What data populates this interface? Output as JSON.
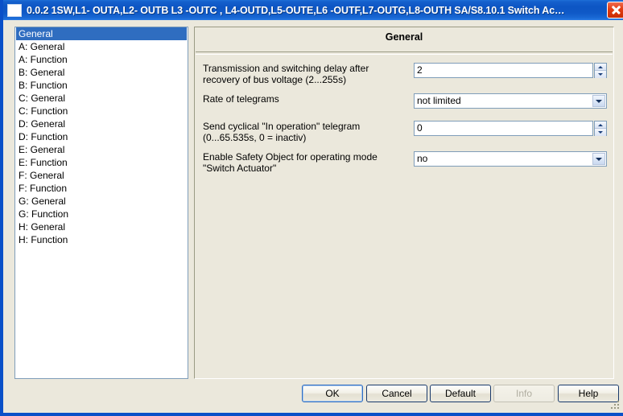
{
  "window": {
    "title": "0.0.2  1SW,L1- OUTA,L2- OUTB L3 -OUTC , L4-OUTD,L5-OUTE,L6 -OUTF,L7-OUTG,L8-OUTH  SA/S8.10.1 Switch Ac…",
    "close_label": "Close",
    "icon": "window-icon",
    "titlebar_color": "#0d55c3",
    "background_color": "#ebe8dc"
  },
  "sidebar": {
    "selected_index": 0,
    "items": [
      {
        "label": "General"
      },
      {
        "label": "A: General"
      },
      {
        "label": "A: Function"
      },
      {
        "label": "B: General"
      },
      {
        "label": "B: Function"
      },
      {
        "label": "C: General"
      },
      {
        "label": "C: Function"
      },
      {
        "label": "D: General"
      },
      {
        "label": "D: Function"
      },
      {
        "label": "E: General"
      },
      {
        "label": "E: Function"
      },
      {
        "label": "F: General"
      },
      {
        "label": "F: Function"
      },
      {
        "label": "G: General"
      },
      {
        "label": "G: Function"
      },
      {
        "label": "H: General"
      },
      {
        "label": "H: Function"
      }
    ]
  },
  "panel": {
    "title": "General",
    "fields": [
      {
        "label_line1": "Transmission and switching delay after",
        "label_line2": "recovery of bus voltage (2...255s)",
        "control": "spinner",
        "value": "2"
      },
      {
        "label_line1": "Rate of telegrams",
        "label_line2": "",
        "control": "combobox",
        "value": "not limited"
      },
      {
        "label_line1": "Send cyclical \"In operation\" telegram",
        "label_line2": "(0...65.535s, 0 = inactiv)",
        "control": "spinner",
        "value": "0"
      },
      {
        "label_line1": "Enable Safety Object for operating mode",
        "label_line2": "\"Switch Actuator\"",
        "control": "combobox",
        "value": "no"
      }
    ]
  },
  "buttons": [
    {
      "label": "OK",
      "state": "focused"
    },
    {
      "label": "Cancel",
      "state": "normal"
    },
    {
      "label": "Default",
      "state": "normal"
    },
    {
      "label": "Info",
      "state": "disabled"
    },
    {
      "label": "Help",
      "state": "normal"
    }
  ]
}
